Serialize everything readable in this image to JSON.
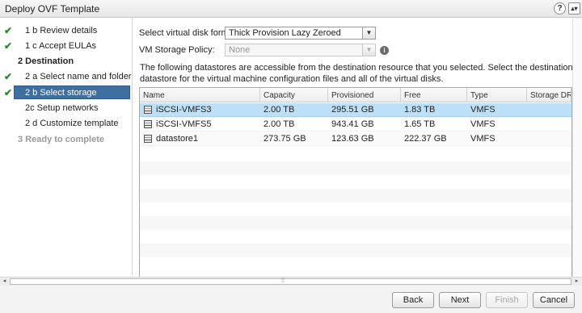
{
  "window": {
    "title": "Deploy OVF Template",
    "help_icon": "?",
    "expand_icon": "▴▾"
  },
  "sidebar": {
    "steps": [
      {
        "label": "1 b  Review details",
        "check": "✔"
      },
      {
        "label": "1 c  Accept EULAs",
        "check": "✔"
      },
      {
        "label": "2  Destination",
        "check": ""
      },
      {
        "label": "2 a  Select name and folder",
        "check": "✔"
      },
      {
        "label": "2 b  Select storage",
        "check": "✔"
      },
      {
        "label": "2c  Setup networks",
        "check": ""
      },
      {
        "label": "2 d  Customize template",
        "check": ""
      },
      {
        "label": "3  Ready to complete",
        "check": ""
      }
    ]
  },
  "form": {
    "disk_format_label": "Select virtual disk format:",
    "disk_format_value": "Thick Provision Lazy Zeroed",
    "storage_policy_label": "VM Storage Policy:",
    "storage_policy_value": "None",
    "info_icon": "i",
    "description": "The following datastores are accessible from the destination resource that you selected. Select the destination datastore for the virtual machine configuration files and all of the virtual disks."
  },
  "table": {
    "columns": [
      "Name",
      "Capacity",
      "Provisioned",
      "Free",
      "Type",
      "Storage DRS"
    ],
    "rows": [
      {
        "name": "iSCSI-VMFS3",
        "capacity": "2.00 TB",
        "provisioned": "295.51 GB",
        "free": "1.83 TB",
        "type": "VMFS",
        "drs": ""
      },
      {
        "name": "iSCSI-VMFS5",
        "capacity": "2.00 TB",
        "provisioned": "943.41 GB",
        "free": "1.65 TB",
        "type": "VMFS",
        "drs": ""
      },
      {
        "name": "datastore1",
        "capacity": "273.75 GB",
        "provisioned": "123.63 GB",
        "free": "222.37 GB",
        "type": "VMFS",
        "drs": ""
      }
    ]
  },
  "scrollbar": {
    "left_arrow": "◂",
    "right_arrow": "▸",
    "grip": "⁞⁞"
  },
  "buttons": {
    "back": "Back",
    "next": "Next",
    "finish": "Finish",
    "cancel": "Cancel"
  },
  "colors": {
    "selected_step": "#3f6fa0",
    "selected_row": "#bde0f7",
    "check": "#2a8a2a"
  }
}
